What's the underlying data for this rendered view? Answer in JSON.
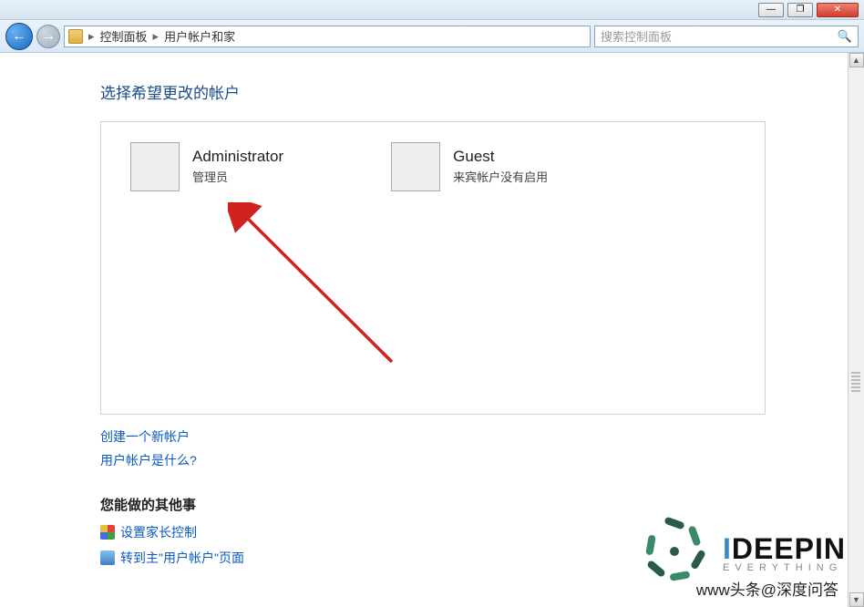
{
  "titlebar": {
    "minimize": "—",
    "maximize": "❐",
    "close": "✕"
  },
  "nav": {
    "back": "←",
    "forward": "→"
  },
  "breadcrumb": {
    "seg1": "控制面板",
    "seg2": "用户帐户和家",
    "chev": "▸"
  },
  "search": {
    "placeholder": "搜索控制面板",
    "icon": "🔍"
  },
  "heading": "选择希望更改的帐户",
  "accounts": {
    "admin": {
      "name": "Administrator",
      "sub": "管理员"
    },
    "guest": {
      "name": "Guest",
      "sub": "来宾帐户没有启用"
    }
  },
  "links": {
    "create": "创建一个新帐户",
    "whatis": "用户帐户是什么?"
  },
  "other": {
    "header": "您能做的其他事",
    "parental": "设置家长控制",
    "gotomain": "转到主\"用户帐户\"页面"
  },
  "watermark": {
    "brand_i": "I",
    "brand_rest": "DEEPIN",
    "sub": "EVERYTHING",
    "credit": "www头条@深度问答"
  }
}
